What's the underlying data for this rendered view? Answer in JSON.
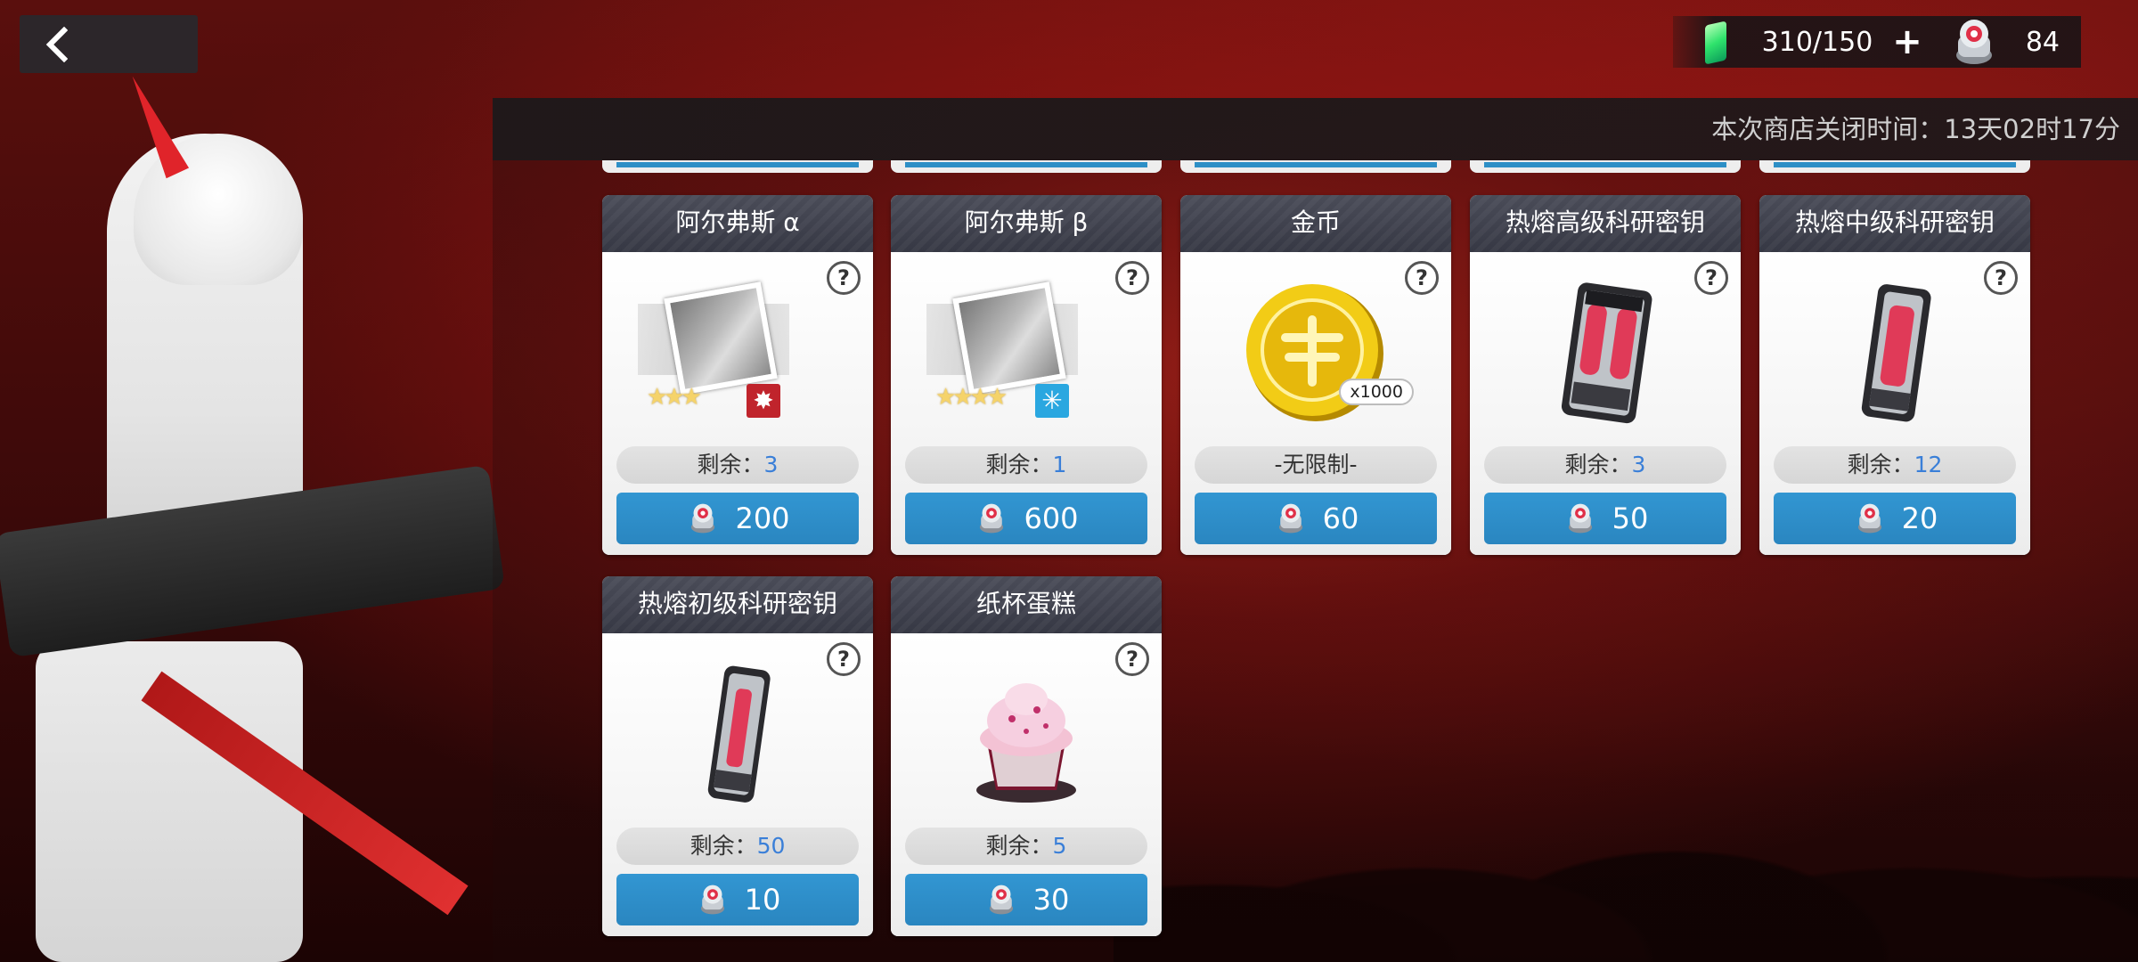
{
  "header": {
    "shop_close_label": "本次商店关闭时间：",
    "shop_close_time": "13天02时17分"
  },
  "resources": {
    "energy_icon": "energy-crystal-icon",
    "energy_value": "310/150",
    "plus_label": "+",
    "currency_icon": "special-coin-icon",
    "currency_value": "84"
  },
  "items": [
    {
      "name": "阿尔弗斯 α",
      "remain_label": "剩余：",
      "remain": "3",
      "price": "200",
      "icon": "character-card-icon",
      "stars": "★★★",
      "badge": "✸"
    },
    {
      "name": "阿尔弗斯 β",
      "remain_label": "剩余：",
      "remain": "1",
      "price": "600",
      "icon": "character-card-icon",
      "stars": "★★★★",
      "badge": "✳"
    },
    {
      "name": "金币",
      "remain_label": "",
      "remain": "-无限制-",
      "price": "60",
      "icon": "gold-coin-icon",
      "qty": "x1000"
    },
    {
      "name": "热熔高级科研密钥",
      "remain_label": "剩余：",
      "remain": "3",
      "price": "50",
      "icon": "advanced-key-icon"
    },
    {
      "name": "热熔中级科研密钥",
      "remain_label": "剩余：",
      "remain": "12",
      "price": "20",
      "icon": "intermediate-key-icon"
    },
    {
      "name": "热熔初级科研密钥",
      "remain_label": "剩余：",
      "remain": "50",
      "price": "10",
      "icon": "basic-key-icon"
    },
    {
      "name": "纸杯蛋糕",
      "remain_label": "剩余：",
      "remain": "5",
      "price": "30",
      "icon": "cupcake-icon"
    }
  ],
  "colors": {
    "price_button": "#2a86c0",
    "remain_number": "#3a7fd8",
    "card_title_bg": "#3f414d"
  }
}
